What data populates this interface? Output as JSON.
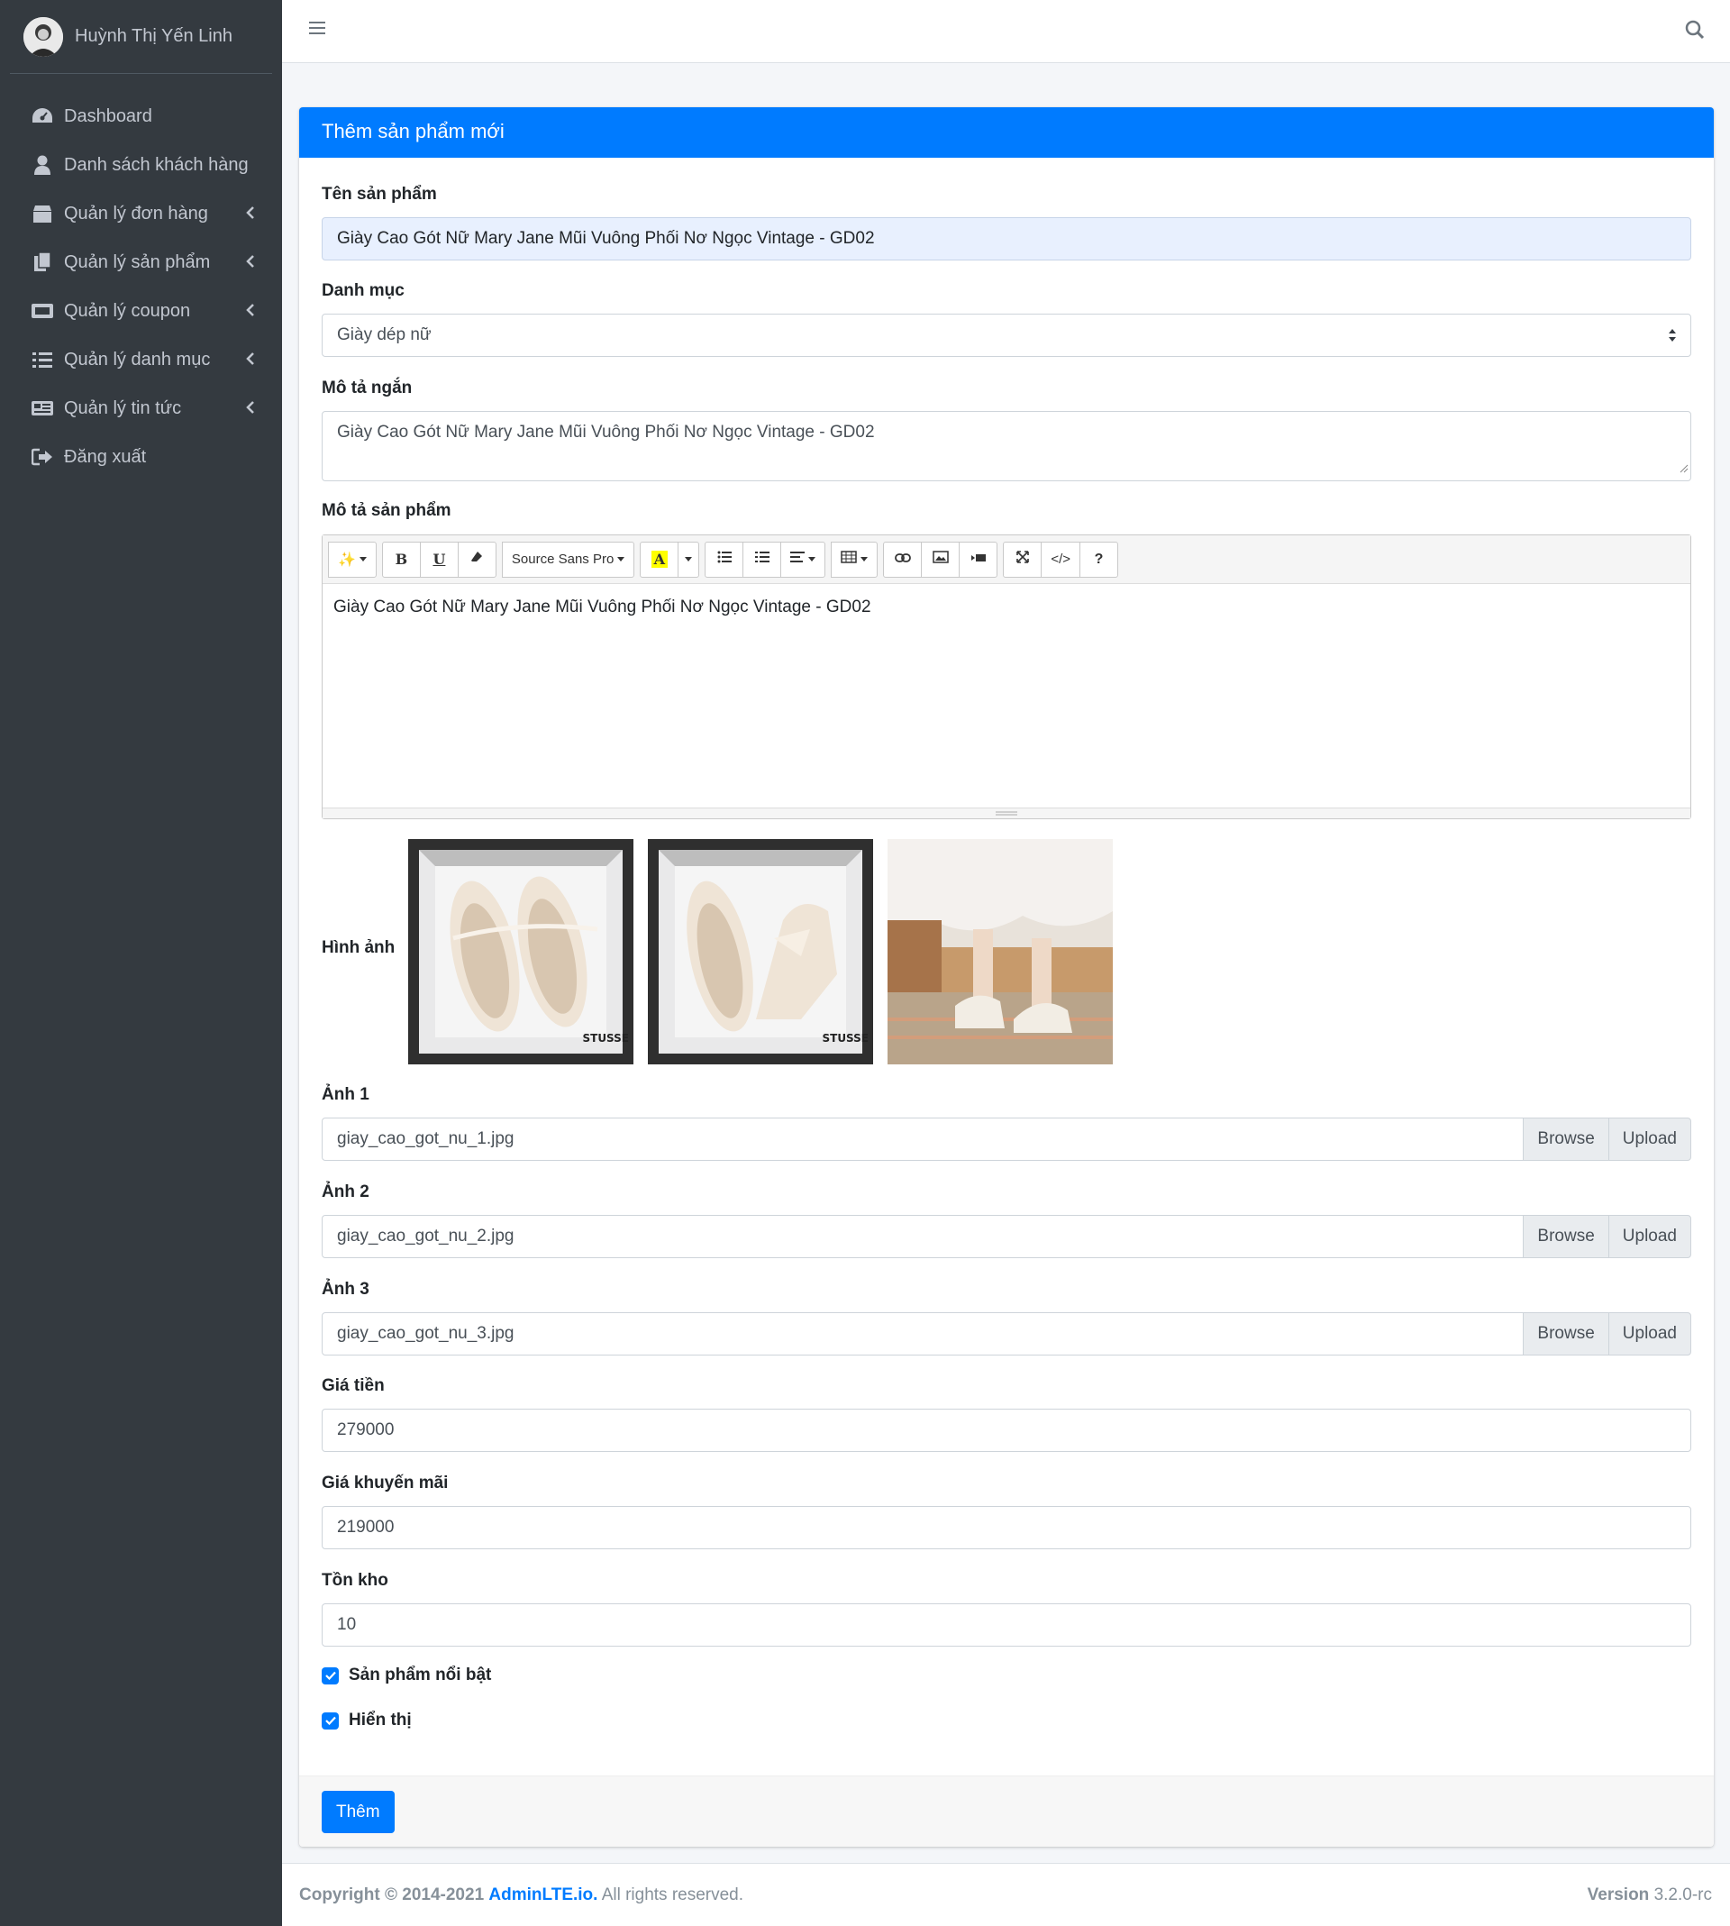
{
  "user": {
    "name": "Huỳnh Thị Yến Linh"
  },
  "sidebar": {
    "items": [
      {
        "label": "Dashboard",
        "icon": "dashboard-icon"
      },
      {
        "label": "Danh sách khách hàng",
        "icon": "user-icon"
      },
      {
        "label": "Quản lý đơn hàng",
        "icon": "box-icon"
      },
      {
        "label": "Quản lý sản phẩm",
        "icon": "copy-icon"
      },
      {
        "label": "Quản lý coupon",
        "icon": "ticket-icon"
      },
      {
        "label": "Quản lý danh mục",
        "icon": "list-icon"
      },
      {
        "label": "Quản lý tin tức",
        "icon": "newspaper-icon"
      },
      {
        "label": "Đăng xuất",
        "icon": "sign-out-icon"
      }
    ]
  },
  "card": {
    "title": "Thêm sản phẩm mới"
  },
  "form": {
    "name_label": "Tên sản phẩm",
    "name_value": "Giày Cao Gót Nữ Mary Jane Mũi Vuông Phối Nơ Ngọc Vintage - GD02",
    "category_label": "Danh mục",
    "category_value": "Giày dép nữ",
    "short_desc_label": "Mô tả ngắn",
    "short_desc_prefix": "Giày Cao Gót Nữ Mary Jane Mũi Vuông Phối Nơ Ngọc Vintage - GD02",
    "desc_label": "Mô tả sản phẩm",
    "editor_font": "Source Sans Pro",
    "desc_value": "Giày Cao Gót Nữ Mary Jane Mũi Vuông Phối Nơ Ngọc Vintage - GD02",
    "images_label": "Hình ảnh",
    "image1_label": "Ảnh 1",
    "image1_file": "giay_cao_got_nu_1.jpg",
    "image2_label": "Ảnh 2",
    "image2_file": "giay_cao_got_nu_2.jpg",
    "image3_label": "Ảnh 3",
    "image3_file": "giay_cao_got_nu_3.jpg",
    "browse": "Browse",
    "upload": "Upload",
    "price_label": "Giá tiền",
    "price_value": "279000",
    "sale_label": "Giá khuyến mãi",
    "sale_value": "219000",
    "stock_label": "Tồn kho",
    "stock_value": "10",
    "featured_label": "Sản phẩm nổi bật",
    "featured_checked": true,
    "visible_label": "Hiển thị",
    "visible_checked": true,
    "submit": "Thêm",
    "thumb_brand": "STUSSE"
  },
  "footer": {
    "copyright": "Copyright © 2014-2021",
    "brand": "AdminLTE.io.",
    "rights": "All rights reserved.",
    "version_label": "Version",
    "version_value": "3.2.0-rc"
  },
  "colors": {
    "primary": "#007bff",
    "sidebar": "#343a40"
  }
}
